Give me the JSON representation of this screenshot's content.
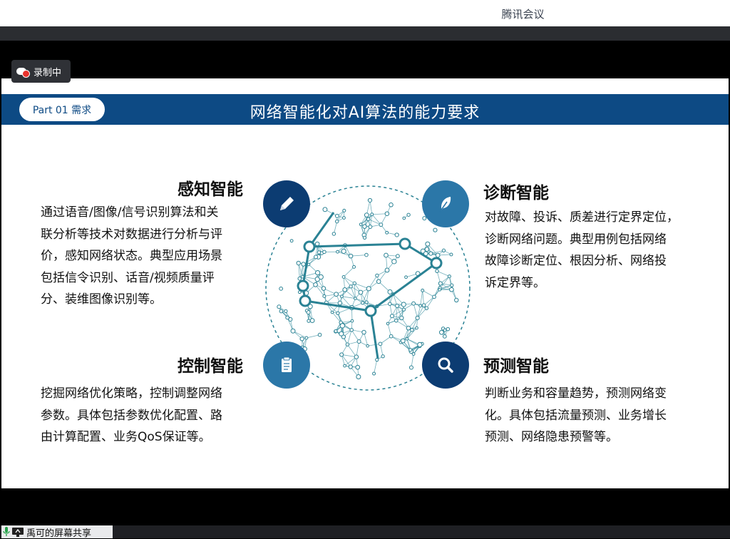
{
  "app": {
    "title": "腾讯会议"
  },
  "recording": {
    "label": "录制中",
    "icon": "cloud-record-icon"
  },
  "slide": {
    "part_label": "Part 01 需求",
    "title": "网络智能化对AI算法的能力要求",
    "sections": [
      {
        "id": "perception",
        "title": "感知智能",
        "icon": "pencil-icon",
        "lines": [
          "通过语音/图像/信号识别算法和关",
          "联分析等技术对数据进行分析与评",
          "价，感知网络状态。典型应用场景",
          "包括信令识别、话音/视频质量评",
          "分、装维图像识别等。"
        ]
      },
      {
        "id": "diagnosis",
        "title": "诊断智能",
        "icon": "feather-icon",
        "lines": [
          "对故障、投诉、质差进行定界定位，",
          "诊断网络问题。典型用例包括网络",
          "故障诊断定位、根因分析、网络投",
          "诉定界等。"
        ]
      },
      {
        "id": "control",
        "title": "控制智能",
        "icon": "clipboard-icon",
        "lines": [
          "挖掘网络优化策略，控制调整网络",
          "参数。具体包括参数优化配置、路",
          "由计算配置、业务QoS保证等。"
        ]
      },
      {
        "id": "prediction",
        "title": "预测智能",
        "icon": "magnifier-icon",
        "lines": [
          "判断业务和容量趋势，预测网络变",
          "化。具体包括流量预测、业务增长",
          "预测、网络隐患预警等。"
        ]
      }
    ]
  },
  "screen_share": {
    "label": "禹可的屏幕共享",
    "mic_icon": "microphone-icon",
    "screen_icon": "screen-share-icon"
  },
  "colors": {
    "header_blue": "#0d4a84",
    "icon_dark": "#0c3c72",
    "icon_light": "#2b77a8",
    "network_teal": "#2a8294"
  }
}
